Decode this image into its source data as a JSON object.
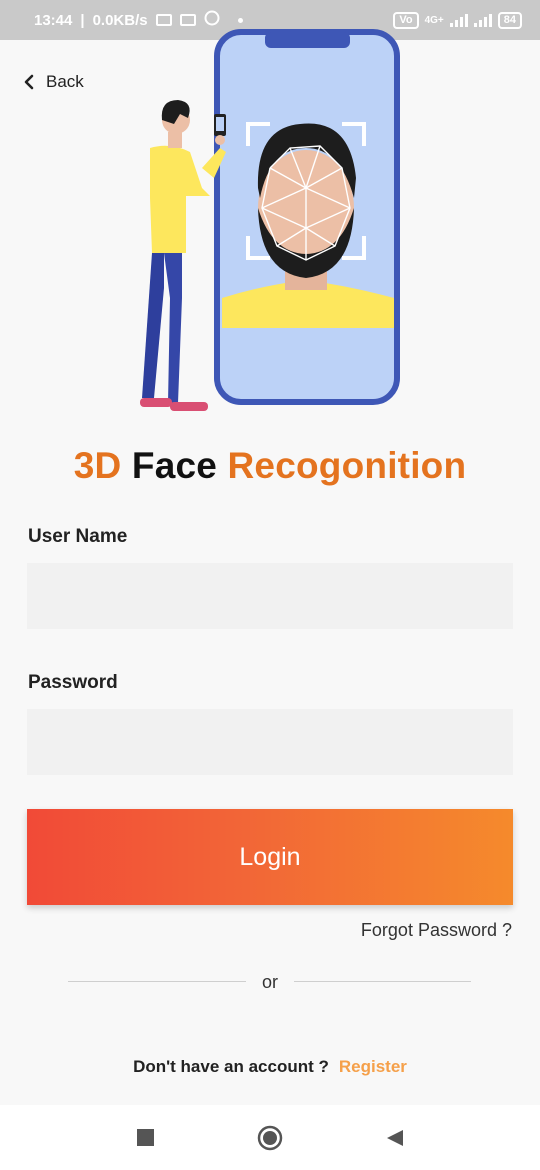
{
  "status_bar": {
    "time": "13:44",
    "speed": "0.0KB/s",
    "network": "4G+",
    "battery": "84"
  },
  "header": {
    "back_label": "Back"
  },
  "title": {
    "part1": "3D",
    "part2": "Face",
    "part3": "Recogonition"
  },
  "form": {
    "username_label": "User Name",
    "username_value": "",
    "password_label": "Password",
    "password_value": "",
    "login_label": "Login",
    "forgot_label": "Forgot Password ?",
    "or_label": "or"
  },
  "footer": {
    "question": "Don't have an account ?",
    "register_label": "Register"
  },
  "colors": {
    "accent_orange": "#e4731f",
    "gradient_start": "#f14a37",
    "gradient_end": "#f58a2c",
    "register": "#f5a04a"
  }
}
